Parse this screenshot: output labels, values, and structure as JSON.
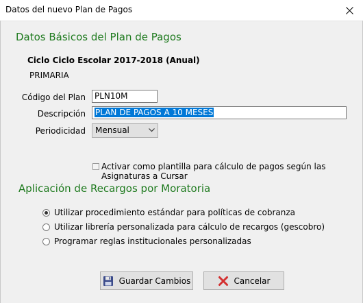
{
  "window": {
    "title": "Datos del nuevo Plan de Pagos"
  },
  "basics": {
    "title": "Datos Básicos del Plan de Pagos",
    "cycle": "Ciclo Ciclo Escolar 2017-2018 (Anual)",
    "level": "PRIMARIA",
    "code_label": "Código del Plan",
    "code_value": "PLN10M",
    "desc_label": "Descripción",
    "desc_value": "PLAN DE PAGOS A 10 MESES",
    "period_label": "Periodicidad",
    "period_value": "Mensual",
    "template_checkbox_label": "Activar como plantilla para cálculo de pagos según las Asignaturas a Cursar",
    "template_checked": false
  },
  "surcharges": {
    "title": "Aplicación de Recargos por Moratoria",
    "options": [
      "Utilizar procedimiento estándar para políticas de cobranza",
      "Utilizar librería personalizada para cálculo de recargos (gescobro)",
      "Programar reglas institucionales personalizadas"
    ],
    "selected_index": 0
  },
  "buttons": {
    "save": "Guardar Cambios",
    "cancel": "Cancelar"
  },
  "colors": {
    "section_title": "#1e7a1e",
    "selection": "#0078d7",
    "cancel_icon": "#d32f2f",
    "save_icon": "#3a4a8a"
  },
  "icons": {
    "close": "close-icon",
    "save": "floppy-disk-icon",
    "cancel": "red-x-icon",
    "dropdown": "chevron-down-icon"
  }
}
